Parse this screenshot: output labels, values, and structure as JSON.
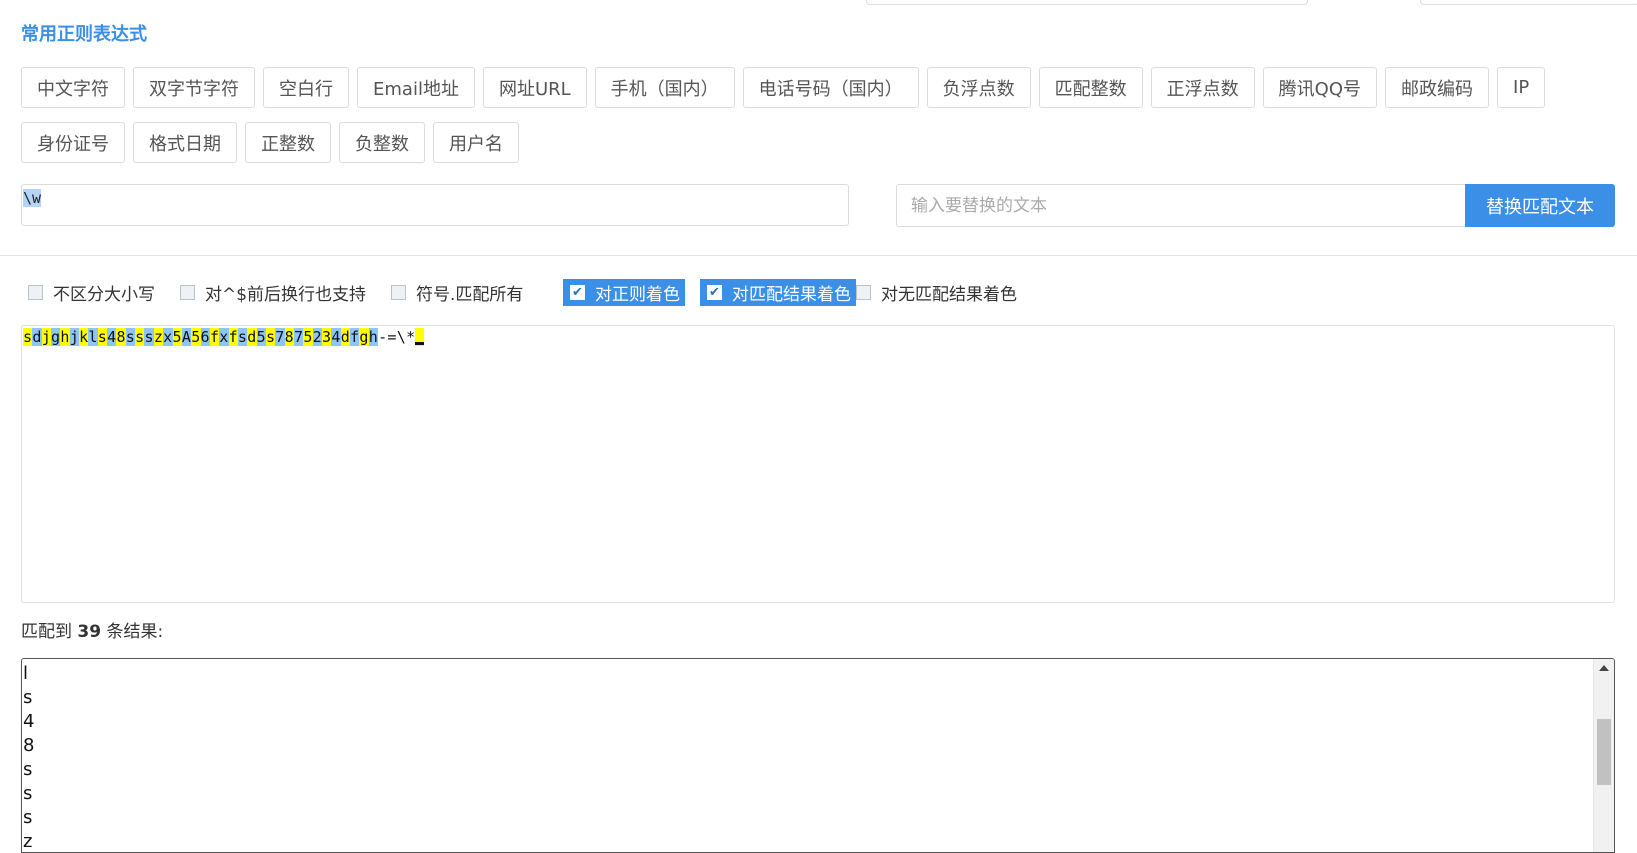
{
  "section_title": "常用正则表达式",
  "quick_buttons": [
    "中文字符",
    "双字节字符",
    "空白行",
    "Email地址",
    "网址URL",
    "手机（国内）",
    "电话号码（国内）",
    "负浮点数",
    "匹配整数",
    "正浮点数",
    "腾讯QQ号",
    "邮政编码",
    "IP",
    "身份证号",
    "格式日期",
    "正整数",
    "负整数",
    "用户名"
  ],
  "regex": {
    "value": "\\w"
  },
  "replace": {
    "placeholder": "输入要替换的文本",
    "button_label": "替换匹配文本"
  },
  "options": [
    {
      "label": "不区分大小写",
      "checked": false
    },
    {
      "label": "对^$前后换行也支持",
      "checked": false
    },
    {
      "label": "符号.匹配所有",
      "checked": false
    },
    {
      "label": "对正则着色",
      "checked": true
    },
    {
      "label": "对匹配结果着色",
      "checked": true
    },
    {
      "label": "对无匹配结果着色",
      "checked": false
    }
  ],
  "test_text": "sdjghjkls48ssszx5A56fxfsd5s7875234dfgh-=\\*",
  "highlight_colors": {
    "match_a": "#ffff00",
    "match_b": "#8ec5f7",
    "accent": "#3b8fe6"
  },
  "result_summary": {
    "prefix": "匹配到 ",
    "count": "39",
    "suffix": " 条结果:"
  },
  "results": [
    "l",
    "s",
    "4",
    "8",
    "s",
    "s",
    "s",
    "z"
  ]
}
